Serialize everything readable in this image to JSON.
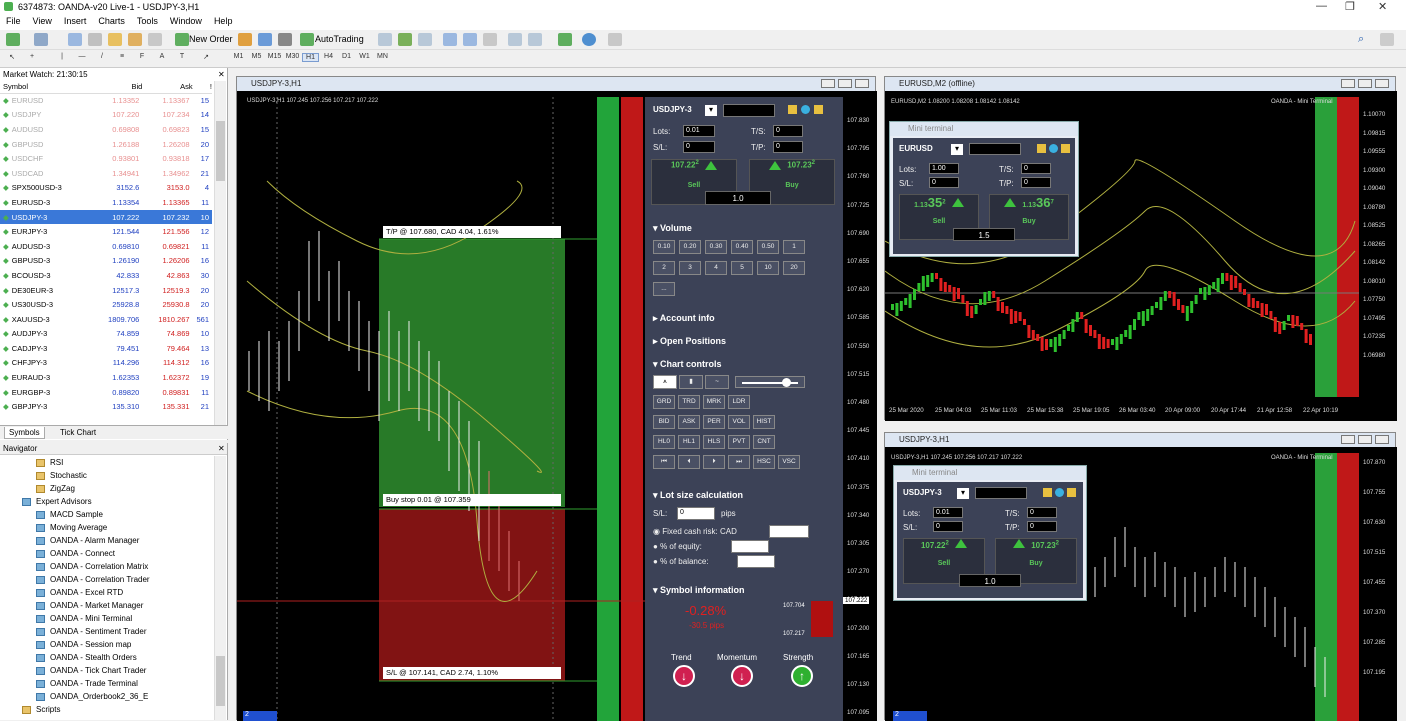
{
  "window": {
    "title": "6374873: OANDA-v20 Live-1 - USDJPY-3,H1"
  },
  "menu": [
    "File",
    "View",
    "Insert",
    "Charts",
    "Tools",
    "Window",
    "Help"
  ],
  "toolbar": {
    "new_order": "New Order",
    "autotrading": "AutoTrading"
  },
  "timeframes": [
    "M1",
    "M5",
    "M15",
    "M30",
    "H1",
    "H4",
    "D1",
    "W1",
    "MN"
  ],
  "market_watch": {
    "title": "Market Watch: 21:30:15",
    "columns": [
      "Symbol",
      "Bid",
      "Ask",
      "!"
    ],
    "rows": [
      {
        "symbol": "EURUSD",
        "bid": "1.13352",
        "ask": "1.13367",
        "spread": "15",
        "faded": true
      },
      {
        "symbol": "USDJPY",
        "bid": "107.220",
        "ask": "107.234",
        "spread": "14",
        "faded": true
      },
      {
        "symbol": "AUDUSD",
        "bid": "0.69808",
        "ask": "0.69823",
        "spread": "15",
        "faded": true
      },
      {
        "symbol": "GBPUSD",
        "bid": "1.26188",
        "ask": "1.26208",
        "spread": "20",
        "faded": true
      },
      {
        "symbol": "USDCHF",
        "bid": "0.93801",
        "ask": "0.93818",
        "spread": "17",
        "faded": true
      },
      {
        "symbol": "USDCAD",
        "bid": "1.34941",
        "ask": "1.34962",
        "spread": "21",
        "faded": true
      },
      {
        "symbol": "SPX500USD-3",
        "bid": "3152.6",
        "ask": "3153.0",
        "spread": "4"
      },
      {
        "symbol": "EURUSD-3",
        "bid": "1.13354",
        "ask": "1.13365",
        "spread": "11"
      },
      {
        "symbol": "USDJPY-3",
        "bid": "107.222",
        "ask": "107.232",
        "spread": "10",
        "selected": true
      },
      {
        "symbol": "EURJPY-3",
        "bid": "121.544",
        "ask": "121.556",
        "spread": "12"
      },
      {
        "symbol": "AUDUSD-3",
        "bid": "0.69810",
        "ask": "0.69821",
        "spread": "11"
      },
      {
        "symbol": "GBPUSD-3",
        "bid": "1.26190",
        "ask": "1.26206",
        "spread": "16"
      },
      {
        "symbol": "BCOUSD-3",
        "bid": "42.833",
        "ask": "42.863",
        "spread": "30"
      },
      {
        "symbol": "DE30EUR-3",
        "bid": "12517.3",
        "ask": "12519.3",
        "spread": "20"
      },
      {
        "symbol": "US30USD-3",
        "bid": "25928.8",
        "ask": "25930.8",
        "spread": "20"
      },
      {
        "symbol": "XAUUSD-3",
        "bid": "1809.706",
        "ask": "1810.267",
        "spread": "561"
      },
      {
        "symbol": "AUDJPY-3",
        "bid": "74.859",
        "ask": "74.869",
        "spread": "10"
      },
      {
        "symbol": "CADJPY-3",
        "bid": "79.451",
        "ask": "79.464",
        "spread": "13"
      },
      {
        "symbol": "CHFJPY-3",
        "bid": "114.296",
        "ask": "114.312",
        "spread": "16"
      },
      {
        "symbol": "EURAUD-3",
        "bid": "1.62353",
        "ask": "1.62372",
        "spread": "19"
      },
      {
        "symbol": "EURGBP-3",
        "bid": "0.89820",
        "ask": "0.89831",
        "spread": "11"
      },
      {
        "symbol": "GBPJPY-3",
        "bid": "135.310",
        "ask": "135.331",
        "spread": "21"
      }
    ],
    "tabs": [
      "Symbols",
      "Tick Chart"
    ]
  },
  "navigator": {
    "title": "Navigator",
    "indicators": [
      "RSI",
      "Stochastic",
      "ZigZag"
    ],
    "expert_advisors_label": "Expert Advisors",
    "experts": [
      "MACD Sample",
      "Moving Average",
      "OANDA - Alarm Manager",
      "OANDA - Connect",
      "OANDA - Correlation Matrix",
      "OANDA - Correlation Trader",
      "OANDA - Excel RTD",
      "OANDA - Market Manager",
      "OANDA - Mini Terminal",
      "OANDA - Sentiment Trader",
      "OANDA - Session map",
      "OANDA - Stealth Orders",
      "OANDA - Tick Chart Trader",
      "OANDA - Trade Terminal",
      "OANDA_Orderbook2_36_E"
    ],
    "scripts_label": "Scripts"
  },
  "main_chart": {
    "caption": "USDJPY-3,H1",
    "info": "USDJPY-3,H1  107.245 107.256 107.217 107.222",
    "tp_label": "T/P @ 107.680, CAD 4.04, 1.61%",
    "entry_label": "Buy stop 0.01 @ 107.359",
    "sl_label": "S/L @ 107.141, CAD 2.74, 1.10%",
    "price_axis": [
      "107.830",
      "107.795",
      "107.760",
      "107.725",
      "107.690",
      "107.655",
      "107.620",
      "107.585",
      "107.550",
      "107.515",
      "107.480",
      "107.445",
      "107.410",
      "107.375",
      "107.340",
      "107.305",
      "107.270",
      "107.235",
      "107.200",
      "107.165",
      "107.130",
      "107.095"
    ],
    "current_price": "107.222",
    "tab_badge": "2"
  },
  "trade_terminal": {
    "symbol": "USDJPY-3",
    "lots_label": "Lots:",
    "lots": "0.01",
    "sl_label": "S/L:",
    "sl": "0",
    "ts_label": "T/S:",
    "ts": "0",
    "tp_label": "T/P:",
    "tp": "0",
    "sell_price": "107.22",
    "sell_sup": "2",
    "buy_price": "107.23",
    "buy_sup": "2",
    "sell_label": "Sell",
    "buy_label": "Buy",
    "spread": "1.0",
    "volume_title": "Volume",
    "volumes": [
      "0.10",
      "0.20",
      "0.30",
      "0.40",
      "0.50",
      "1",
      "2",
      "3",
      "4",
      "5",
      "10",
      "20",
      "..."
    ],
    "account_info": "Account info",
    "open_positions": "Open Positions",
    "chart_controls": "Chart controls",
    "control_buttons": [
      "GRD",
      "TRD",
      "MRK",
      "LDR",
      "BID",
      "ASK",
      "PER",
      "VOL",
      "HIST",
      "HL0",
      "HL1",
      "HLS",
      "PVT",
      "CNT",
      "HSC",
      "VSC"
    ],
    "lot_calc_title": "Lot size calculation",
    "sl_pips_label": "S/L:",
    "sl_pips": "0",
    "pips_label": "pips",
    "fixed_risk": "Fixed cash risk: CAD",
    "pct_equity": "% of equity:",
    "pct_balance": "% of balance:",
    "symbol_info_title": "Symbol information",
    "change_pct": "-0.28%",
    "change_pips": "-30.5 pips",
    "range_high": "107.704",
    "range_low": "107.217",
    "trend": "Trend",
    "momentum": "Momentum",
    "strength": "Strength"
  },
  "eurusd_chart": {
    "caption": "EURUSD,M2 (offline)",
    "info": "EURUSD,M2  1.08200 1.08208 1.08142 1.08142",
    "brand": "OANDA - Mini Terminal",
    "price_axis": [
      "1.10070",
      "1.09815",
      "1.09555",
      "1.09300",
      "1.09040",
      "1.08780",
      "1.08525",
      "1.08265",
      "1.08142",
      "1.08010",
      "1.07750",
      "1.07495",
      "1.07235",
      "1.06980"
    ],
    "time_axis": [
      "25 Mar 2020",
      "25 Mar 04:03",
      "25 Mar 11:03",
      "25 Mar 15:38",
      "25 Mar 19:05",
      "26 Mar 03:40",
      "20 Apr 09:00",
      "20 Apr 17:44",
      "21 Apr 12:58",
      "22 Apr 10:19"
    ],
    "mini": {
      "title": "Mini terminal",
      "symbol": "EURUSD",
      "lots": "1.00",
      "sl": "0",
      "ts": "0",
      "tp": "0",
      "sell": "1.13",
      "sell_big": "35",
      "sell_sup": "2",
      "buy": "1.13",
      "buy_big": "36",
      "buy_sup": "7",
      "sell_label": "Sell",
      "buy_label": "Buy",
      "spread": "1.5"
    }
  },
  "usdjpy_chart2": {
    "caption": "USDJPY-3,H1",
    "info": "USDJPY-3,H1  107.245 107.256 107.217 107.222",
    "brand": "OANDA - Mini Terminal",
    "price_axis": [
      "107.870",
      "107.755",
      "107.630",
      "107.515",
      "107.455",
      "107.370",
      "107.285",
      "107.195"
    ],
    "tab_badge": "2",
    "mini": {
      "title": "Mini terminal",
      "symbol": "USDJPY-3",
      "lots": "0.01",
      "sl": "0",
      "ts": "0",
      "tp": "0",
      "sell": "107.22",
      "sell_sup": "2",
      "buy": "107.23",
      "buy_sup": "2",
      "sell_label": "Sell",
      "buy_label": "Buy",
      "spread": "1.0"
    }
  }
}
